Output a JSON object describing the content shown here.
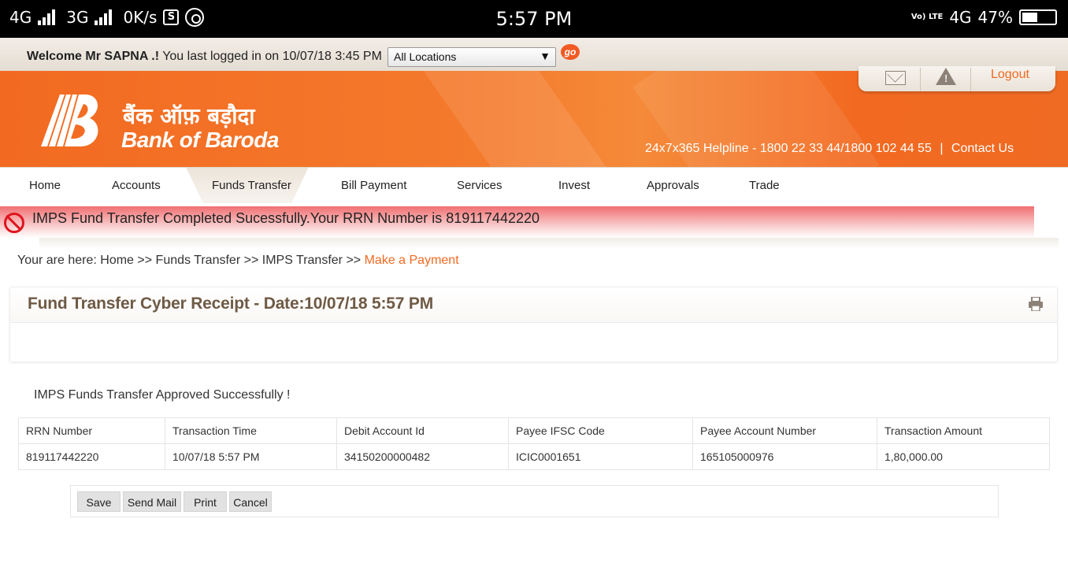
{
  "status_bar": {
    "net1": "4G",
    "net2": "3G",
    "speed": "0K/s",
    "time": "5:57 PM",
    "volte": "Vo) LTE",
    "net3": "4G",
    "battery": "47%",
    "icons": [
      "signal-icon",
      "signal-icon",
      "screenshot-icon",
      "whatsapp-icon",
      "volte-icon",
      "battery-icon"
    ]
  },
  "welcome": {
    "greeting": "Welcome Mr SAPNA .!",
    "last_login": "You last logged in on 10/07/18 3:45 PM",
    "location_selected": "All Locations",
    "go_label": "go"
  },
  "header": {
    "logo_hindi": "बैंक ऑफ़ बड़ौदा",
    "logo_english": "Bank of Baroda",
    "helpline": "24x7x365 Helpline - 1800 22 33 44/1800 102 44 55",
    "helpline_sep": "|",
    "contact": "Contact Us",
    "logout": "Logout"
  },
  "nav": {
    "items": [
      "Home",
      "Accounts",
      "Funds Transfer",
      "Bill Payment",
      "Services",
      "Invest",
      "Approvals",
      "Trade"
    ],
    "active": "Funds Transfer"
  },
  "message": {
    "text": "IMPS Fund Transfer Completed Sucessfully.Your RRN Number is 819117442220"
  },
  "breadcrumb": {
    "prefix": "Your are here:",
    "items": [
      "Home",
      "Funds Transfer",
      "IMPS Transfer"
    ],
    "sep": ">>",
    "current": "Make a Payment"
  },
  "receipt": {
    "title": "Fund Transfer Cyber Receipt - Date:10/07/18 5:57 PM",
    "approved_text": "IMPS Funds Transfer Approved Successfully !",
    "columns": [
      "RRN Number",
      "Transaction Time",
      "Debit Account Id",
      "Payee IFSC Code",
      "Payee Account Number",
      "Transaction Amount"
    ],
    "row": [
      "819117442220",
      "10/07/18 5:57 PM",
      "34150200000482",
      "ICIC0001651",
      "165105000976",
      "1,80,000.00"
    ]
  },
  "actions": {
    "save": "Save",
    "send_mail": "Send Mail",
    "print": "Print",
    "cancel": "Cancel"
  },
  "colors": {
    "brand_orange": "#f26a21",
    "title_brown": "#6e5a45",
    "error_red": "#e0141e"
  }
}
